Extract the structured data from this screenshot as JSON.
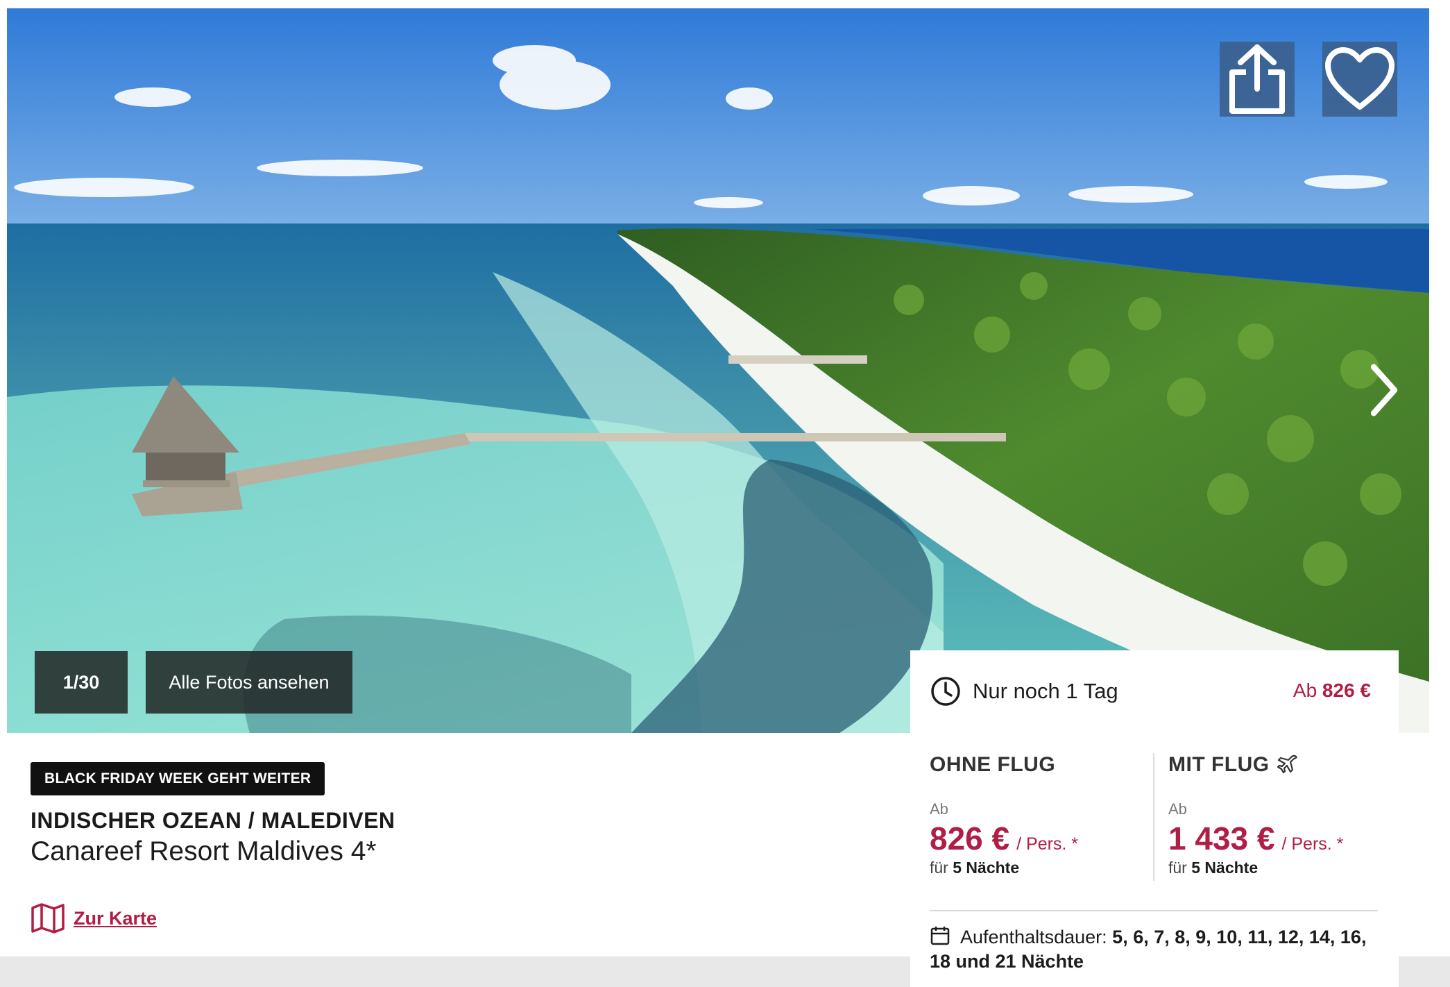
{
  "gallery": {
    "counter": "1/30",
    "all_photos_label": "Alle Fotos ansehen",
    "share_icon": "share-icon",
    "favorite_icon": "heart-icon",
    "next_icon": "chevron-right-icon"
  },
  "offer": {
    "badge": "BLACK FRIDAY WEEK GEHT WEITER",
    "destination": "INDISCHER OZEAN / MALEDIVEN",
    "hotel": "Canareef Resort Maldives 4*",
    "map_link": "Zur Karte"
  },
  "price_card": {
    "deadline": "Nur noch 1 Tag",
    "from_prefix": "Ab",
    "from_price": "826 €",
    "without_flight": {
      "title": "OHNE FLUG",
      "from": "Ab",
      "price": "826 €",
      "per_person": "/ Pers. *",
      "nights_prefix": "für",
      "nights": "5 Nächte"
    },
    "with_flight": {
      "title": "MIT FLUG",
      "from": "Ab",
      "price": "1 433 €",
      "per_person": "/ Pers. *",
      "nights_prefix": "für",
      "nights": "5 Nächte"
    },
    "stay_label": "Aufenthaltsdauer:",
    "stay_values": "5, 6, 7, 8, 9, 10, 11, 12, 14, 16, 18 und 21 Nächte"
  },
  "colors": {
    "accent": "#b01e45",
    "overlay_button": "#3a5f8c",
    "dark_chip": "#232a28"
  }
}
